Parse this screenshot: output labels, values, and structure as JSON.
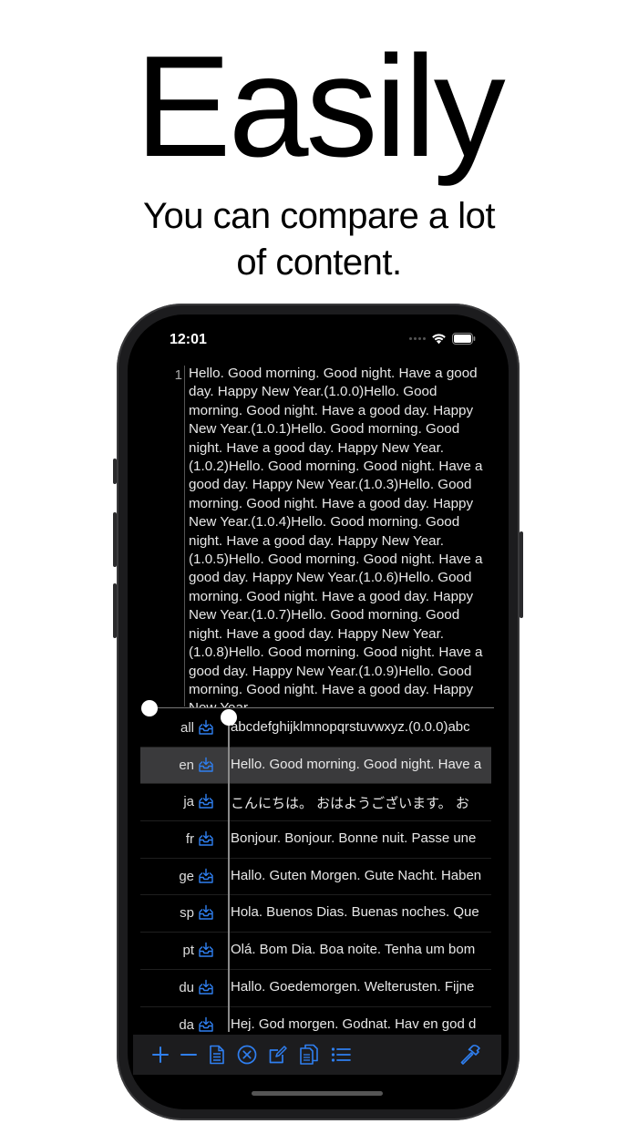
{
  "headline": "Easily",
  "subtitle_line1": "You can compare a lot",
  "subtitle_line2": "of content.",
  "status_bar": {
    "time": "12:01"
  },
  "editor": {
    "line_number": "1",
    "content": "Hello. Good morning. Good night. Have a good day. Happy New Year.(1.0.0)Hello. Good morning. Good night. Have a good day. Happy New Year.(1.0.1)Hello. Good morning. Good night. Have a good day. Happy New Year.(1.0.2)Hello. Good morning. Good night. Have a good day. Happy New Year.(1.0.3)Hello. Good morning. Good night. Have a good day. Happy New Year.(1.0.4)Hello. Good morning. Good night. Have a good day. Happy New Year.(1.0.5)Hello. Good morning. Good night. Have a good day. Happy New Year.(1.0.6)Hello. Good morning. Good night. Have a good day. Happy New Year.(1.0.7)Hello. Good morning. Good night. Have a good day. Happy New Year.(1.0.8)Hello. Good morning. Good night. Have a good day. Happy New Year.(1.0.9)Hello. Good morning. Good night. Have a good day. Happy New Year."
  },
  "languages": [
    {
      "code": "all",
      "text": "abcdefghijklmnopqrstuvwxyz.(0.0.0)abc",
      "selected": false
    },
    {
      "code": "en",
      "text": "Hello. Good morning. Good night. Have a",
      "selected": true
    },
    {
      "code": "ja",
      "text": "こんにちは。 おはようございます。 お",
      "selected": false
    },
    {
      "code": "fr",
      "text": "Bonjour. Bonjour. Bonne nuit. Passe une",
      "selected": false
    },
    {
      "code": "ge",
      "text": "Hallo. Guten Morgen. Gute Nacht. Haben",
      "selected": false
    },
    {
      "code": "sp",
      "text": "Hola. Buenos Dias. Buenas noches. Que",
      "selected": false
    },
    {
      "code": "pt",
      "text": "Olá. Bom Dia. Boa noite. Tenha um bom",
      "selected": false
    },
    {
      "code": "du",
      "text": "Hallo. Goedemorgen. Welterusten. Fijne",
      "selected": false
    },
    {
      "code": "da",
      "text": "Hej. God morgen. Godnat. Hav en god d",
      "selected": false
    }
  ],
  "toolbar": {
    "icons": [
      "plus-icon",
      "minus-icon",
      "document-icon",
      "clear-icon",
      "edit-icon",
      "copy-icon",
      "list-icon",
      "hammer-icon"
    ]
  },
  "colors": {
    "accent": "#2f7ff0",
    "screen_bg": "#000000",
    "selected_row": "#3a3a3c"
  }
}
